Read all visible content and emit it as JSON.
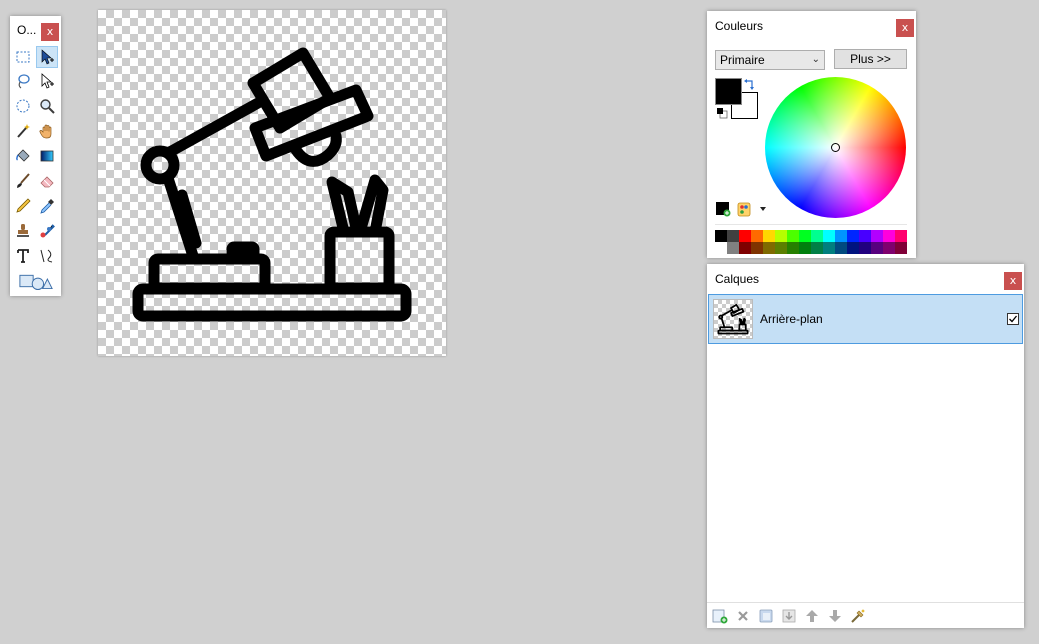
{
  "tools_window": {
    "title": "O...",
    "close_label": "x"
  },
  "colors_window": {
    "title": "Couleurs",
    "close_label": "x",
    "mode_value": "Primaire",
    "more_button_label": "Plus >>",
    "primary_color": "#000000",
    "secondary_color": "#ffffff",
    "palette_top": [
      "#000000",
      "#404040",
      "#ff0000",
      "#ff6a00",
      "#ffd800",
      "#b6ff00",
      "#4cff00",
      "#00ff21",
      "#00ff90",
      "#00ffff",
      "#0094ff",
      "#0026ff",
      "#4800ff",
      "#b200ff",
      "#ff00dc",
      "#ff006e"
    ],
    "palette_bottom": [
      "#ffffff",
      "#808080",
      "#7f0000",
      "#7f3300",
      "#7f6a00",
      "#5b7f00",
      "#267f00",
      "#007f0e",
      "#007f46",
      "#007f7f",
      "#004a7f",
      "#00137f",
      "#21007f",
      "#57007f",
      "#7f006e",
      "#7f0037"
    ]
  },
  "layers_window": {
    "title": "Calques",
    "close_label": "x",
    "layers": [
      {
        "name": "Arrière-plan",
        "visible": true,
        "selected": true
      }
    ]
  }
}
